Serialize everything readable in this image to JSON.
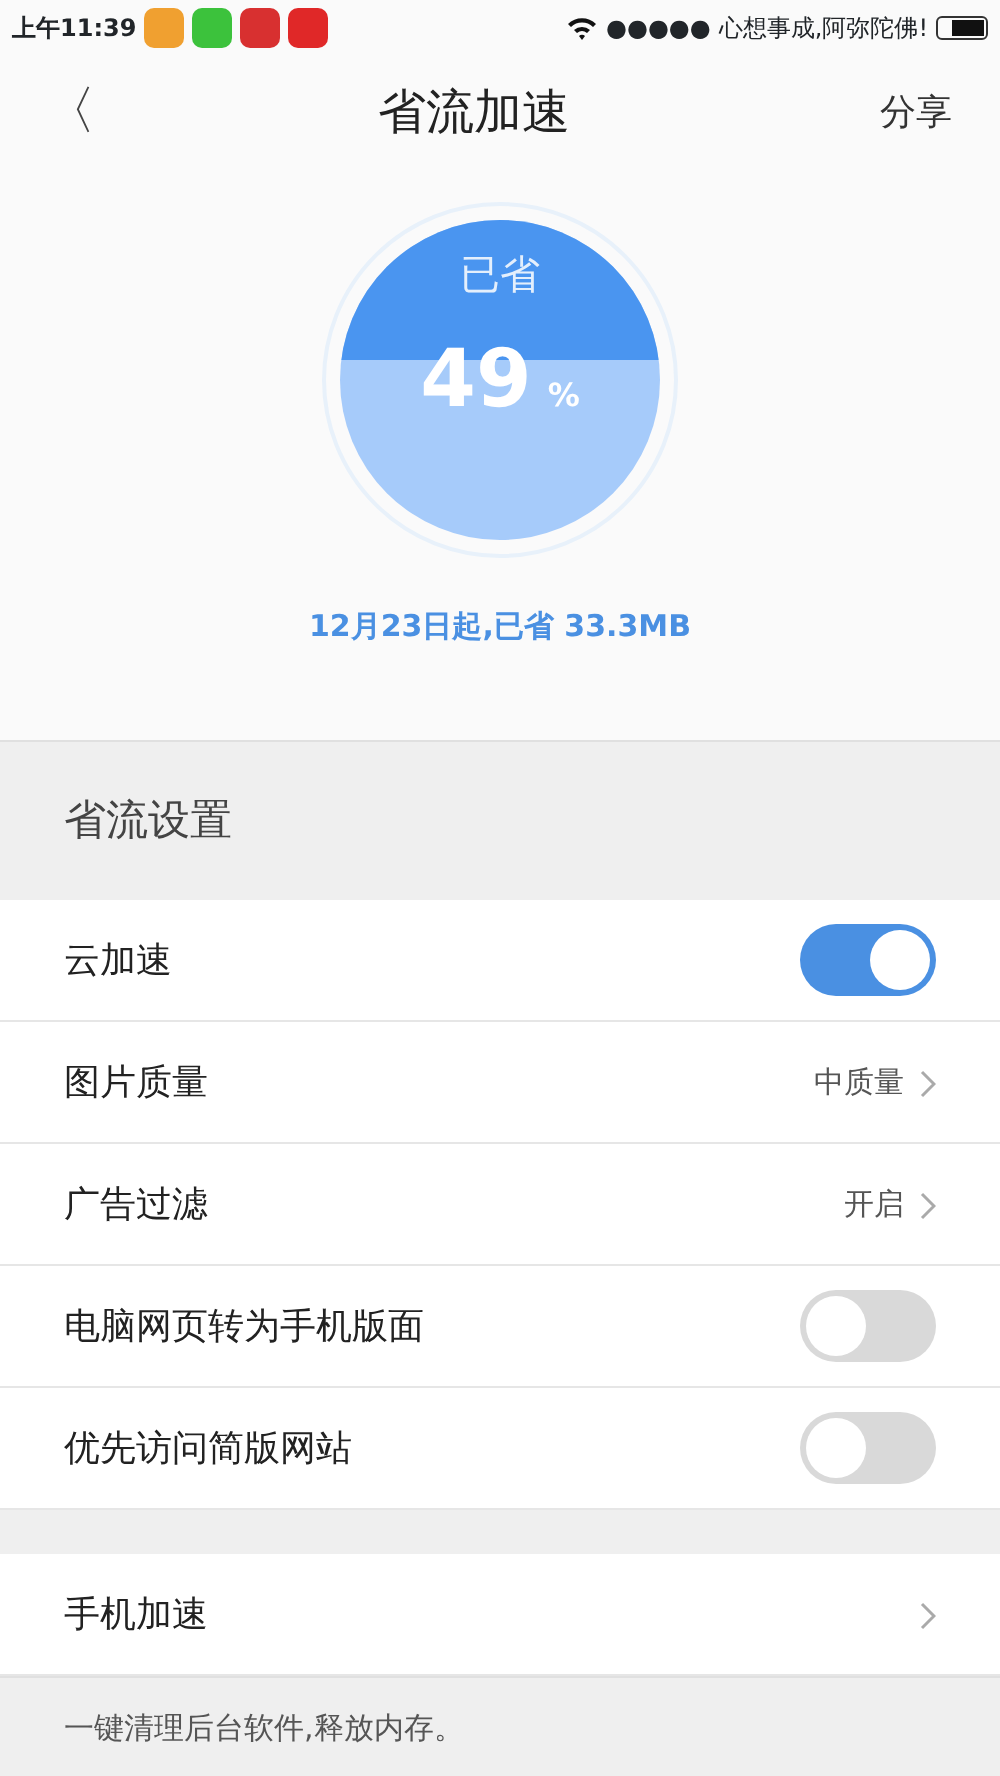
{
  "status_bar": {
    "time": "上午11:39",
    "app_icons": [
      {
        "color": "#f0a030"
      },
      {
        "color": "#3cc23c"
      },
      {
        "color": "#d83030"
      },
      {
        "color": "#e02828"
      }
    ],
    "signal": "●●●●●",
    "carrier": "心想事成,阿弥陀佛!"
  },
  "nav": {
    "back": "〈",
    "title": "省流加速",
    "action": "分享"
  },
  "gauge": {
    "label": "已省",
    "value": "49",
    "unit": "%"
  },
  "summary": "12月23日起,已省 33.3MB",
  "section_title": "省流设置",
  "settings": [
    {
      "kind": "toggle",
      "label": "云加速",
      "on": true
    },
    {
      "kind": "link",
      "label": "图片质量",
      "value": "中质量"
    },
    {
      "kind": "link",
      "label": "广告过滤",
      "value": "开启"
    },
    {
      "kind": "toggle",
      "label": "电脑网页转为手机版面",
      "on": false
    },
    {
      "kind": "toggle",
      "label": "优先访问简版网站",
      "on": false
    }
  ],
  "phone_boost": {
    "label": "手机加速"
  },
  "footer": "一键清理后台软件,释放内存。"
}
